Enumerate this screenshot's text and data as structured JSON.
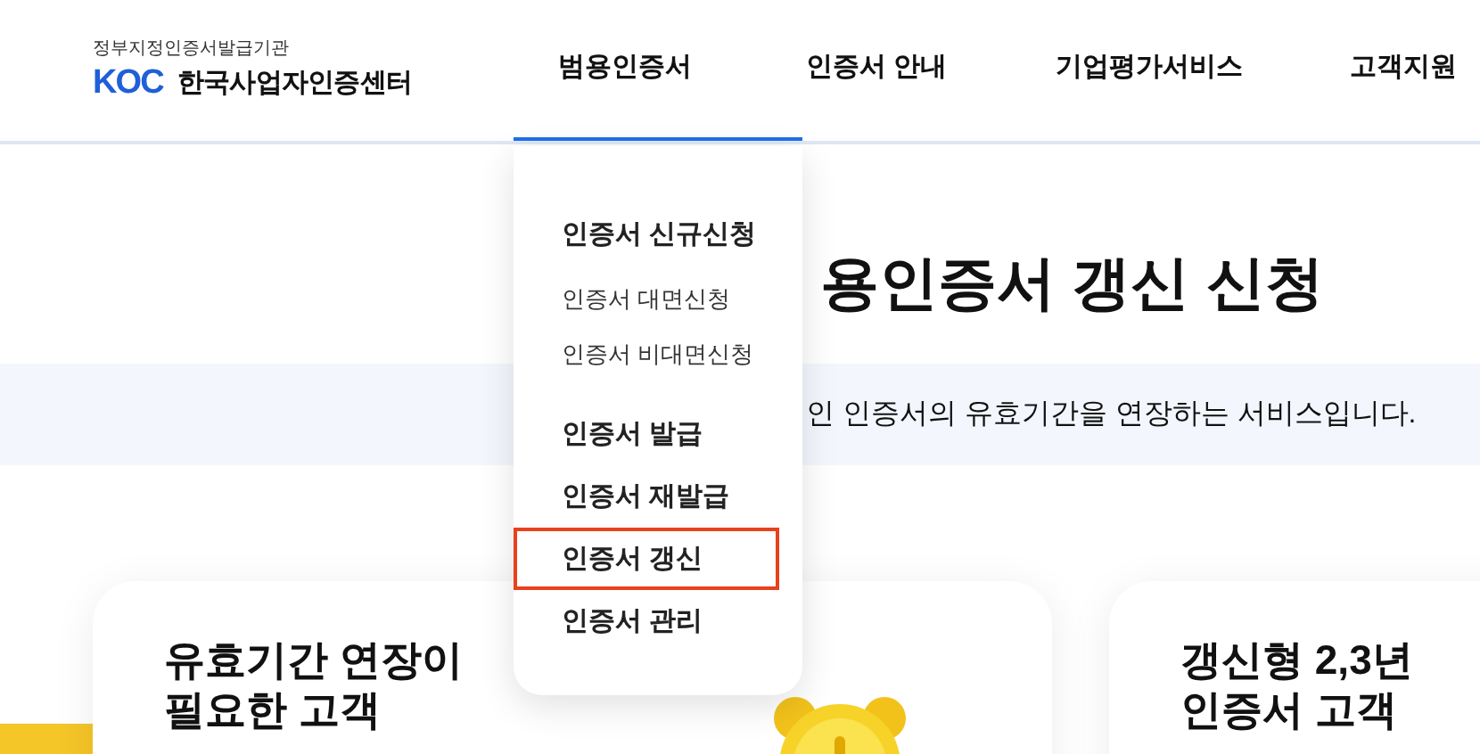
{
  "header": {
    "tagline": "정부지정인증서발급기관",
    "logo_mark": "KOC",
    "logo_name": "한국사업자인증센터",
    "nav": [
      {
        "label": "범용인증서",
        "selected": true
      },
      {
        "label": "인증서 안내",
        "selected": false
      },
      {
        "label": "기업평가서비스",
        "selected": false
      },
      {
        "label": "고객지원",
        "selected": false
      }
    ]
  },
  "dropdown": {
    "items": [
      {
        "label": "인증서 신규신청",
        "kind": "primary",
        "highlighted": false
      },
      {
        "label": "인증서 대면신청",
        "kind": "sub",
        "highlighted": false
      },
      {
        "label": "인증서 비대면신청",
        "kind": "sub",
        "highlighted": false
      },
      {
        "label": "인증서 발급",
        "kind": "primary",
        "highlighted": false
      },
      {
        "label": "인증서 재발급",
        "kind": "primary",
        "highlighted": false
      },
      {
        "label": "인증서 갱신",
        "kind": "primary",
        "highlighted": true
      },
      {
        "label": "인증서 관리",
        "kind": "primary",
        "highlighted": false
      }
    ]
  },
  "page": {
    "title": "용인증서 갱신 신청",
    "subtitle": "인 인증서의 유효기간을 연장하는 서비스입니다."
  },
  "cards": [
    {
      "title_lines": [
        "유효기간 연장이",
        "필요한 고객"
      ],
      "kind": "clock"
    },
    {
      "title_lines": [
        "갱신형 2,3년",
        "인증서 고객"
      ],
      "kind": "plain"
    }
  ]
}
